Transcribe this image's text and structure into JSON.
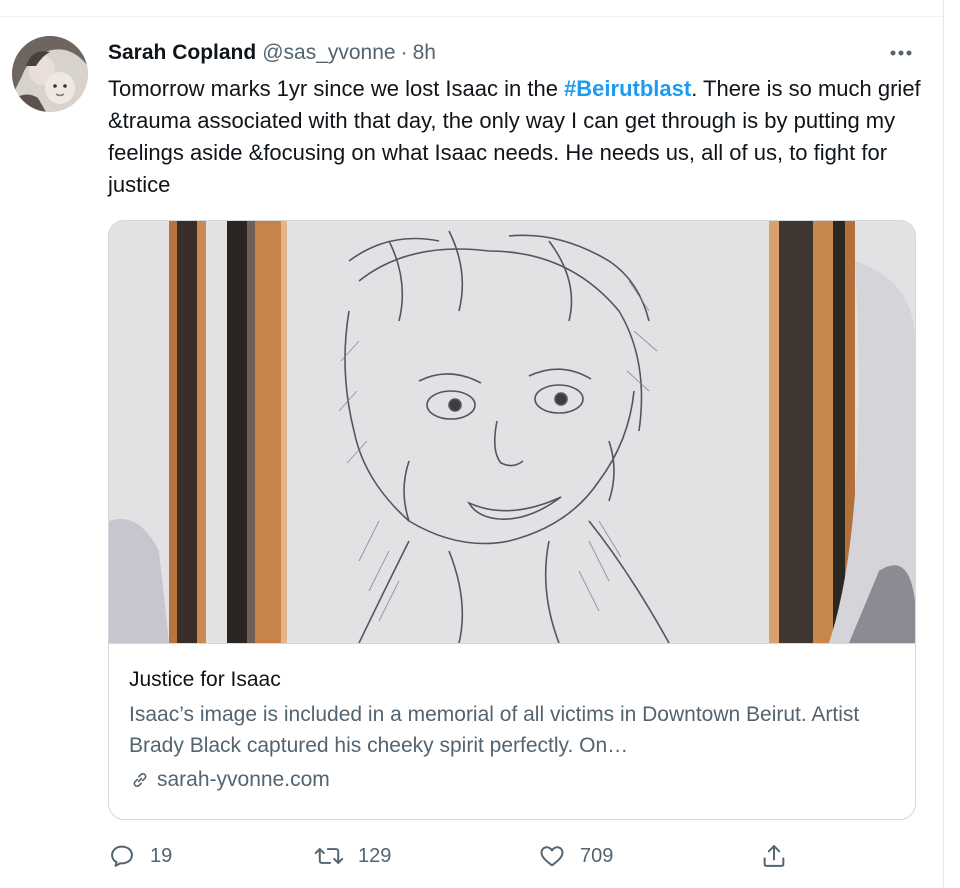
{
  "tweet": {
    "author_name": "Sarah Copland",
    "handle": "@sas_yvonne",
    "separator": "·",
    "time": "8h",
    "text_before": "Tomorrow marks 1yr since we lost Isaac in the ",
    "hashtag": "#Beirutblast",
    "text_after": ". There is so much grief &trauma associated with that day, the only way I can get through is by putting my feelings aside &focusing on what Isaac needs. He needs us, all of us, to fight for justice",
    "more_icon": "more-horizontal-icon"
  },
  "card": {
    "title": "Justice for Isaac",
    "description": "Isaac’s image is included in a memorial of all victims in Downtown Beirut. Artist Brady Black captured his cheeky spirit perfectly. On…",
    "domain": "sarah-yvonne.com",
    "link_icon": "link-icon"
  },
  "actions": {
    "reply": {
      "icon": "reply-icon",
      "count": "19"
    },
    "retweet": {
      "icon": "retweet-icon",
      "count": "129"
    },
    "like": {
      "icon": "heart-icon",
      "count": "709"
    },
    "share": {
      "icon": "share-icon"
    }
  },
  "colors": {
    "text": "#0f1419",
    "secondary": "#536471",
    "accent": "#1d9bf0",
    "border": "#cfd9de"
  }
}
